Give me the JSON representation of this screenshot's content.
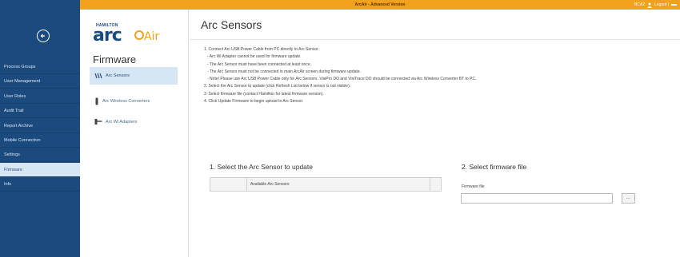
{
  "topbar": {
    "title": "ArcAir - Advanced Version",
    "user": "BCA2",
    "logout": "Logout |"
  },
  "nav": {
    "items": [
      {
        "label": "Process Groups"
      },
      {
        "label": "User Management"
      },
      {
        "label": "User Roles"
      },
      {
        "label": "Audit Trail"
      },
      {
        "label": "Report Archive"
      },
      {
        "label": "Mobile Connection"
      },
      {
        "label": "Settings"
      },
      {
        "label": "Firmware"
      },
      {
        "label": "Info"
      }
    ],
    "active_index": 7
  },
  "logo": {
    "hamilton": "HAMILTON",
    "arc": "arc",
    "air": "Air"
  },
  "subnav": {
    "title": "Firmware",
    "items": [
      {
        "label": "Arc Sensors",
        "icon": "sensor-icon"
      },
      {
        "label": "Arc Wireless Converters",
        "icon": "wireless-converter-icon"
      },
      {
        "label": "Arc Wi Adapters",
        "icon": "wi-adapter-icon"
      }
    ],
    "active_index": 0
  },
  "main": {
    "title": "Arc Sensors",
    "instructions": [
      {
        "text": "1. Connect Arc USB Power Cable from PC directly to Arc Sensor.",
        "indent": false
      },
      {
        "text": "- Arc Wi Adapter cannot be used for firmware update.",
        "indent": true
      },
      {
        "text": "- The Arc Sensor must have been connected at least once.",
        "indent": true
      },
      {
        "text": "- The Arc Sensor must not be connected in main ArcAir screen during firmware update.",
        "indent": true
      },
      {
        "text": "- Note! Please use Arc USB Power Cable only for Arc Sensors. VisiPro DO and VisiTrace DO should be connected via Arc Wireless Converter BT to PC.",
        "indent": true
      },
      {
        "text": "2. Select the Arc Sensor to update (click Refresh List below if sensor is not visible).",
        "indent": false
      },
      {
        "text": "3. Select firmware file (contact Hamilton for latest firmware version).",
        "indent": false
      },
      {
        "text": "4. Click Update Firmware to begin upload to Arc Sensor.",
        "indent": false
      }
    ],
    "step1_title": "1. Select the Arc Sensor to update",
    "sensor_table_header": "Available Arc Sensors",
    "step2_title": "2. Select firmware file",
    "firmware_label": "Firmware file",
    "firmware_value": "",
    "browse_label": "..."
  },
  "colors": {
    "nav_bg": "#1b4a7e",
    "topbar": "#f2a11c",
    "active_bg": "#d6e6f5"
  }
}
